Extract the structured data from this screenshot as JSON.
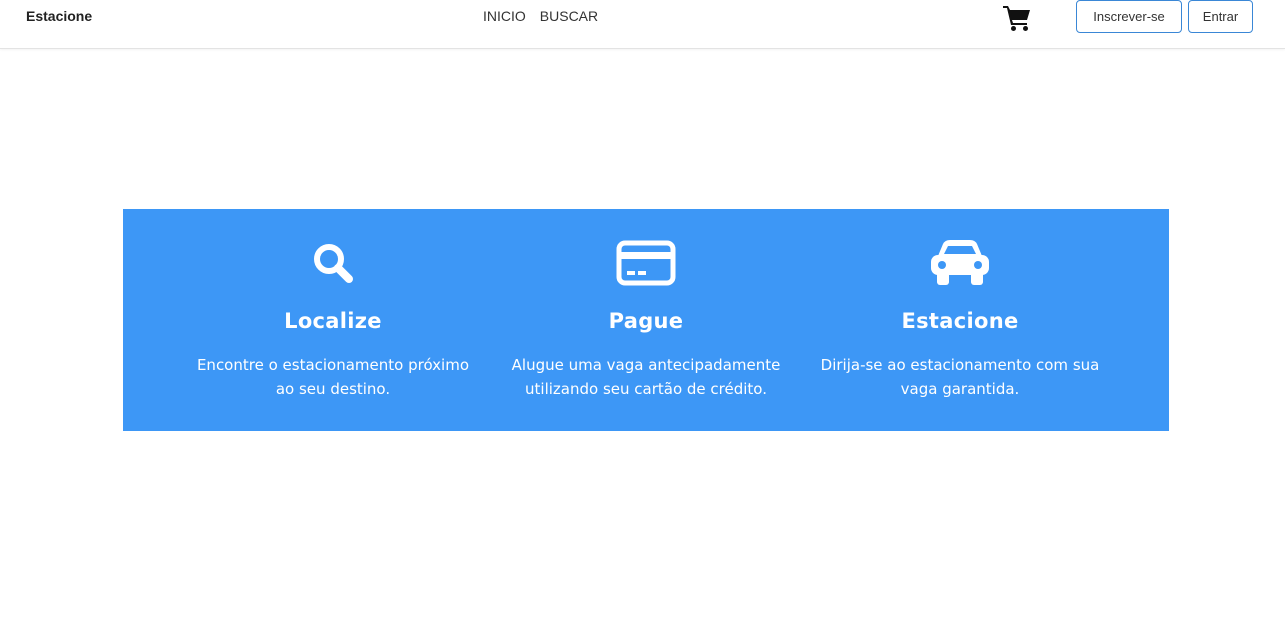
{
  "navbar": {
    "brand": "Estacione",
    "links": [
      "INICIO",
      "BUSCAR"
    ],
    "cart_icon": "shopping-cart-icon",
    "signup_label": "Inscrever-se",
    "login_label": "Entrar"
  },
  "banner": {
    "background_color": "#3d97f6",
    "features": [
      {
        "icon": "search-icon",
        "title": "Localize",
        "desc_line1": "Encontre o estacionamento próximo",
        "desc_line2": "ao seu destino."
      },
      {
        "icon": "credit-card-icon",
        "title": "Pague",
        "desc_line1": "Alugue uma vaga antecipadamente",
        "desc_line2": "utilizando seu cartão de crédito."
      },
      {
        "icon": "car-icon",
        "title": "Estacione",
        "desc_line1": "Dirija-se ao estacionamento com sua",
        "desc_line2": "vaga garantida."
      }
    ]
  }
}
